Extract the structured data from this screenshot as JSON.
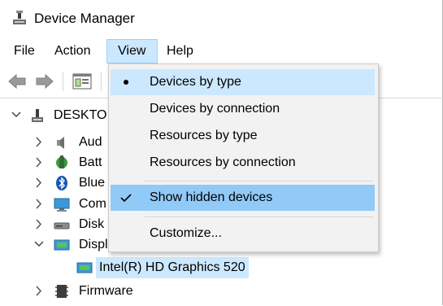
{
  "window": {
    "title": "Device Manager"
  },
  "menubar": {
    "items": [
      {
        "label": "File"
      },
      {
        "label": "Action"
      },
      {
        "label": "View"
      },
      {
        "label": "Help"
      }
    ]
  },
  "toolbar": {
    "buttons": [
      "back-arrow-icon",
      "forward-arrow-icon",
      "properties-icon"
    ]
  },
  "tree": {
    "root": "DESKTO",
    "items": [
      {
        "label": "Aud",
        "icon": "speaker-icon",
        "expanded": false
      },
      {
        "label": "Batt",
        "icon": "battery-icon",
        "expanded": false
      },
      {
        "label": "Blue",
        "icon": "bluetooth-icon",
        "expanded": false
      },
      {
        "label": "Com",
        "icon": "monitor-icon",
        "expanded": false
      },
      {
        "label": "Disk",
        "icon": "disk-drive-icon",
        "expanded": false
      },
      {
        "label": "Display adapters",
        "icon": "display-adapter-icon",
        "expanded": true
      },
      {
        "label": "Intel(R) HD Graphics 520",
        "icon": "display-adapter-icon",
        "selected": true
      },
      {
        "label": "Firmware",
        "icon": "firmware-chip-icon",
        "expanded": false
      }
    ]
  },
  "view_menu": {
    "items": [
      {
        "label": "Devices by type",
        "mark": "radio-dot"
      },
      {
        "label": "Devices by connection"
      },
      {
        "label": "Resources by type"
      },
      {
        "label": "Resources by connection"
      },
      {
        "label": "Show hidden devices",
        "mark": "checkmark"
      },
      {
        "label": "Customize..."
      }
    ]
  },
  "colors": {
    "menu_active_bg": "#cce8ff",
    "menu_hover_bg": "#91c9f7",
    "selection_bg": "#cce8ff"
  }
}
